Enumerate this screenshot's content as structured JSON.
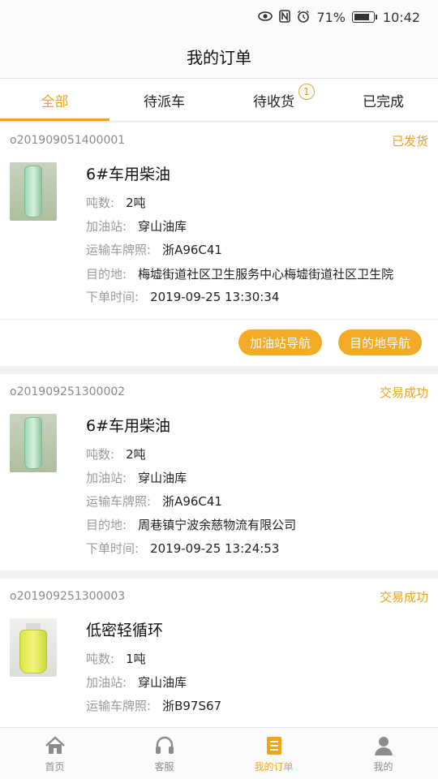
{
  "status_bar": {
    "battery_pct": "71%",
    "time": "10:42",
    "icons": [
      "eye-icon",
      "nfc-icon",
      "alarm-icon",
      "battery-icon"
    ]
  },
  "header": {
    "title": "我的订单"
  },
  "tabs": [
    {
      "label": "全部",
      "active": true
    },
    {
      "label": "待派车",
      "active": false
    },
    {
      "label": "待收货",
      "active": false,
      "badge": "1"
    },
    {
      "label": "已完成",
      "active": false
    }
  ],
  "labels": {
    "tonnage": "吨数:",
    "station": "加油站:",
    "plate": "运输车牌照:",
    "destination": "目的地:",
    "order_time": "下单时间:"
  },
  "orders": [
    {
      "order_no": "o201909051400001",
      "status": "已发货",
      "product": "6#车用柴油",
      "tonnage": "2吨",
      "station": "穿山油库",
      "plate": "浙A96C41",
      "destination": "梅墟街道社区卫生服务中心梅墟街道社区卫生院",
      "order_time": "2019-09-25 13:30:34",
      "actions": [
        "加油站导航",
        "目的地导航"
      ]
    },
    {
      "order_no": "o201909251300002",
      "status": "交易成功",
      "product": "6#车用柴油",
      "tonnage": "2吨",
      "station": "穿山油库",
      "plate": "浙A96C41",
      "destination": "周巷镇宁波余慈物流有限公司",
      "order_time": "2019-09-25 13:24:53"
    },
    {
      "order_no": "o201909251300003",
      "status": "交易成功",
      "product": "低密轻循环",
      "tonnage": "1吨",
      "station": "穿山油库",
      "plate": "浙B97S67"
    }
  ],
  "bottom_nav": [
    {
      "label": "首页",
      "icon": "home-icon",
      "active": false
    },
    {
      "label": "客服",
      "icon": "headset-icon",
      "active": false
    },
    {
      "label": "我的订单",
      "icon": "order-list-icon",
      "active": true
    },
    {
      "label": "我的",
      "icon": "user-icon",
      "active": false
    }
  ],
  "colors": {
    "accent": "#f0a41b",
    "button": "#f2aa27"
  }
}
